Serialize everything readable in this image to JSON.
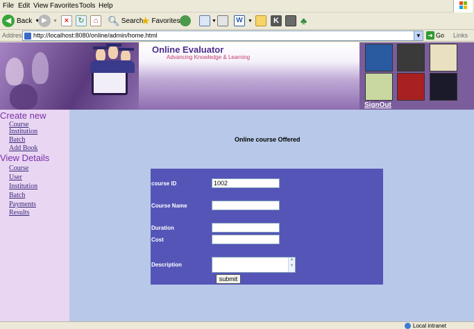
{
  "menubar": {
    "items": [
      "File",
      "Edit",
      "View",
      "Favorites",
      "Tools",
      "Help"
    ]
  },
  "toolbar": {
    "back_label": "Back",
    "search_label": "Search",
    "favorites_label": "Favorites"
  },
  "addressbar": {
    "label": "Address",
    "url": "http://localhost:8080/online/admin/home.html",
    "go_label": "Go",
    "links_label": "Links"
  },
  "header": {
    "title": "Online Evaluator",
    "tagline": "Advancing Knowledge & Learning",
    "signout_label": "SignOut"
  },
  "sidebar": {
    "create_heading": "Create new",
    "create_items": [
      "Course",
      "Institution",
      "Batch",
      "Add Book"
    ],
    "view_heading": "View Details",
    "view_items": [
      "Course",
      "User",
      "Institution",
      "Batch",
      "Payments",
      "Results"
    ]
  },
  "main": {
    "title": "Online course Offered",
    "form": {
      "course_id_label": "course ID",
      "course_id_value": "1002",
      "course_name_label": "Course Name",
      "course_name_value": "",
      "duration_label": "Duration",
      "duration_value": "",
      "cost_label": "Cost",
      "cost_value": "",
      "description_label": "Description",
      "description_value": "",
      "submit_label": "submit"
    }
  },
  "statusbar": {
    "zone": "Local intranet"
  },
  "colors": {
    "banner": "#7d5aa0",
    "sidebar": "#e9d6f2",
    "main_bg": "#b8c8e8",
    "form_panel": "#5555b8",
    "heading": "#7a2ea8"
  },
  "icons": [
    "back-icon",
    "forward-icon",
    "stop-icon",
    "refresh-icon",
    "home-icon",
    "search-icon",
    "favorites-star-icon",
    "media-icon",
    "mail-icon",
    "print-icon",
    "edit-icon",
    "folder-icon",
    "messenger-icon",
    "windows-logo-icon",
    "go-arrow-icon",
    "globe-icon"
  ]
}
